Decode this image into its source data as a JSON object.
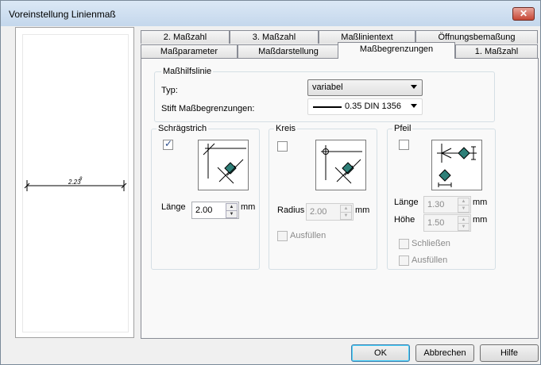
{
  "window": {
    "title": "Voreinstellung Linienmaß",
    "close_icon": "close-icon"
  },
  "preview": {
    "dimension_text": "2.23",
    "dimension_superscript": "8"
  },
  "tabs_top": [
    {
      "label": "2. Maßzahl"
    },
    {
      "label": "3. Maßzahl"
    },
    {
      "label": "Maßlinientext"
    },
    {
      "label": "Öffnungsbemaßung"
    }
  ],
  "tabs_bottom": [
    {
      "label": "Maßparameter"
    },
    {
      "label": "Maßdarstellung"
    },
    {
      "label": "Maßbegrenzungen",
      "active": true
    },
    {
      "label": "1. Maßzahl"
    }
  ],
  "masshilfslinie": {
    "title": "Maßhilfslinie",
    "typ_label": "Typ:",
    "typ_value": "variabel",
    "stift_label": "Stift Maßbegrenzungen:",
    "stift_value": "0.35 DIN 1356"
  },
  "schraegstrich": {
    "title": "Schrägstrich",
    "checked": true,
    "laenge_label": "Länge",
    "laenge_value": "2.00",
    "unit": "mm"
  },
  "kreis": {
    "title": "Kreis",
    "checked": false,
    "radius_label": "Radius",
    "radius_value": "2.00",
    "unit": "mm",
    "ausfuellen_label": "Ausfüllen"
  },
  "pfeil": {
    "title": "Pfeil",
    "checked": false,
    "laenge_label": "Länge",
    "laenge_value": "1.30",
    "hoehe_label": "Höhe",
    "hoehe_value": "1.50",
    "unit": "mm",
    "schliessen_label": "Schließen",
    "ausfuellen_label": "Ausfüllen"
  },
  "buttons": {
    "ok": "OK",
    "cancel": "Abbrechen",
    "help": "Hilfe"
  },
  "colors": {
    "marker_fill": "#2e7f78",
    "title_bg": "#c4d7ec"
  }
}
